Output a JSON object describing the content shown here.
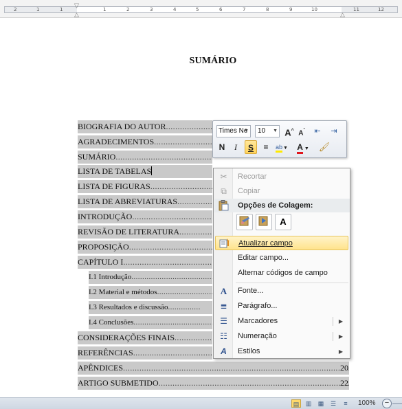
{
  "ruler": {
    "numbers_left": [
      "2",
      "1",
      "1"
    ],
    "numbers_right": [
      "1",
      "2",
      "3",
      "4",
      "5",
      "6",
      "7",
      "8",
      "9",
      "10",
      "11",
      "12"
    ]
  },
  "document": {
    "title": "SUMÁRIO",
    "toc": [
      {
        "text": "BIOGRAFIA DO AUTOR",
        "page": ""
      },
      {
        "text": "AGRADECIMENTOS",
        "page": ""
      },
      {
        "text": "SUMÁRIO",
        "page": ""
      },
      {
        "text": "LISTA DE TABELAS",
        "page": ""
      },
      {
        "text": "LISTA DE FIGURAS",
        "page": ""
      },
      {
        "text": "LISTA DE ABREVIATURAS",
        "page": ""
      },
      {
        "text": "INTRODUÇÃO",
        "page": ""
      },
      {
        "text": "REVISÃO DE LITERATURA",
        "page": ""
      },
      {
        "text": "PROPOSIÇÃO",
        "page": ""
      },
      {
        "text": "CAPÍTULO I",
        "page": ""
      },
      {
        "text": "I.1 Introdução",
        "page": ""
      },
      {
        "text": "I.2 Material e métodos",
        "page": ""
      },
      {
        "text": "I.3 Resultados e discussão",
        "page": ""
      },
      {
        "text": "I.4 Conclusões",
        "page": ""
      },
      {
        "text": "CONSIDERAÇÕES FINAIS",
        "page": ""
      },
      {
        "text": "REFERÊNCIAS",
        "page": ""
      },
      {
        "text": "APÊNDICES",
        "page": "20"
      },
      {
        "text": "ARTIGO SUBMETIDO",
        "page": "22"
      }
    ]
  },
  "mini_toolbar": {
    "font_name": "Times Ne",
    "font_size": "10",
    "grow_font": "A",
    "shrink_font": "A",
    "bold": "N",
    "italic": "I",
    "underline": "S",
    "font_color_glyph": "A",
    "accent": "#ffd35a"
  },
  "context_menu": {
    "cut": "Recortar",
    "copy": "Copiar",
    "paste_options_header": "Opções de Colagem:",
    "paste_text_only": "A",
    "update_field": "Atualizar campo",
    "edit_field": "Editar campo...",
    "toggle_field_codes": "Alternar códigos de campo",
    "font": "Fonte...",
    "font_icon": "A",
    "paragraph": "Parágrafo...",
    "bullets": "Marcadores",
    "numbering": "Numeração",
    "styles": "Estilos",
    "highlight_color": "#ffe38c"
  },
  "statusbar": {
    "zoom": "100%",
    "zoom_out": "−"
  }
}
